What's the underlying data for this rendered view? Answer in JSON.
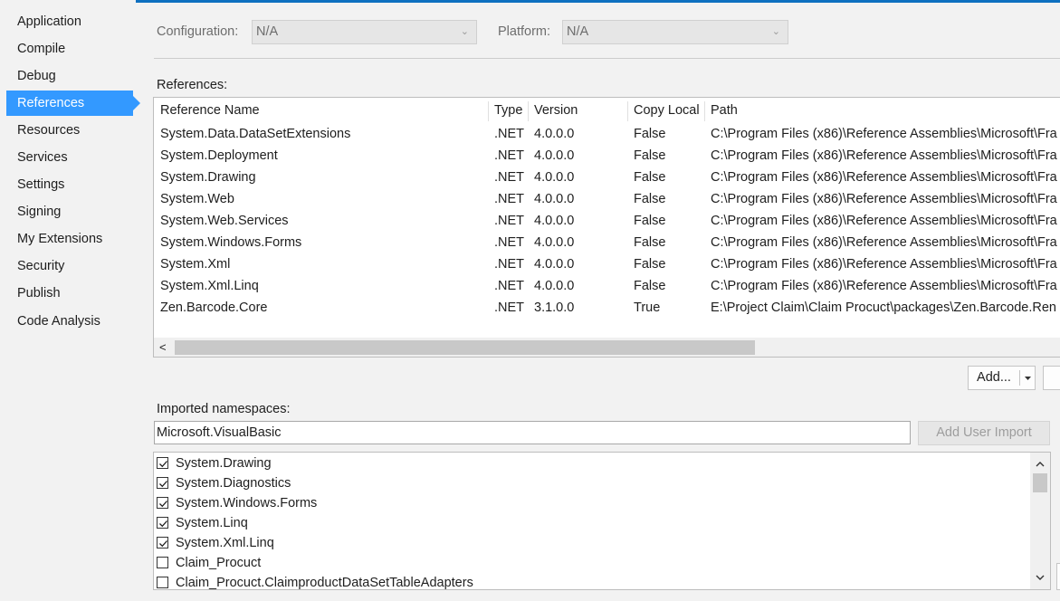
{
  "sidebar": {
    "items": [
      {
        "label": "Application",
        "active": false
      },
      {
        "label": "Compile",
        "active": false
      },
      {
        "label": "Debug",
        "active": false
      },
      {
        "label": "References",
        "active": true
      },
      {
        "label": "Resources",
        "active": false
      },
      {
        "label": "Services",
        "active": false
      },
      {
        "label": "Settings",
        "active": false
      },
      {
        "label": "Signing",
        "active": false
      },
      {
        "label": "My Extensions",
        "active": false
      },
      {
        "label": "Security",
        "active": false
      },
      {
        "label": "Publish",
        "active": false
      },
      {
        "label": "Code Analysis",
        "active": false
      }
    ]
  },
  "config": {
    "configuration_label": "Configuration:",
    "configuration_value": "N/A",
    "platform_label": "Platform:",
    "platform_value": "N/A"
  },
  "references": {
    "label": "References:",
    "columns": [
      "Reference Name",
      "Type",
      "Version",
      "Copy Local",
      "Path"
    ],
    "rows": [
      [
        "System.Data.DataSetExtensions",
        ".NET",
        "4.0.0.0",
        "False",
        "C:\\Program Files (x86)\\Reference Assemblies\\Microsoft\\Fra"
      ],
      [
        "System.Deployment",
        ".NET",
        "4.0.0.0",
        "False",
        "C:\\Program Files (x86)\\Reference Assemblies\\Microsoft\\Fra"
      ],
      [
        "System.Drawing",
        ".NET",
        "4.0.0.0",
        "False",
        "C:\\Program Files (x86)\\Reference Assemblies\\Microsoft\\Fra"
      ],
      [
        "System.Web",
        ".NET",
        "4.0.0.0",
        "False",
        "C:\\Program Files (x86)\\Reference Assemblies\\Microsoft\\Fra"
      ],
      [
        "System.Web.Services",
        ".NET",
        "4.0.0.0",
        "False",
        "C:\\Program Files (x86)\\Reference Assemblies\\Microsoft\\Fra"
      ],
      [
        "System.Windows.Forms",
        ".NET",
        "4.0.0.0",
        "False",
        "C:\\Program Files (x86)\\Reference Assemblies\\Microsoft\\Fra"
      ],
      [
        "System.Xml",
        ".NET",
        "4.0.0.0",
        "False",
        "C:\\Program Files (x86)\\Reference Assemblies\\Microsoft\\Fra"
      ],
      [
        "System.Xml.Linq",
        ".NET",
        "4.0.0.0",
        "False",
        "C:\\Program Files (x86)\\Reference Assemblies\\Microsoft\\Fra"
      ],
      [
        "Zen.Barcode.Core",
        ".NET",
        "3.1.0.0",
        "True",
        "E:\\Project Claim\\Claim Procuct\\packages\\Zen.Barcode.Ren"
      ]
    ],
    "add_button_label": "Add...",
    "scroll_left_glyph": "<"
  },
  "imports": {
    "label": "Imported namespaces:",
    "input_value": "Microsoft.VisualBasic",
    "add_user_import_label": "Add User Import",
    "namespaces": [
      {
        "name": "System.Drawing",
        "checked": true
      },
      {
        "name": "System.Diagnostics",
        "checked": true
      },
      {
        "name": "System.Windows.Forms",
        "checked": true
      },
      {
        "name": "System.Linq",
        "checked": true
      },
      {
        "name": "System.Xml.Linq",
        "checked": true
      },
      {
        "name": "Claim_Procuct",
        "checked": false
      },
      {
        "name": "Claim_Procuct.ClaimproductDataSetTableAdapters",
        "checked": false
      }
    ]
  },
  "colors": {
    "accent": "#3399ff",
    "top_bar": "#0e70c0",
    "background": "#f2f2f2"
  }
}
